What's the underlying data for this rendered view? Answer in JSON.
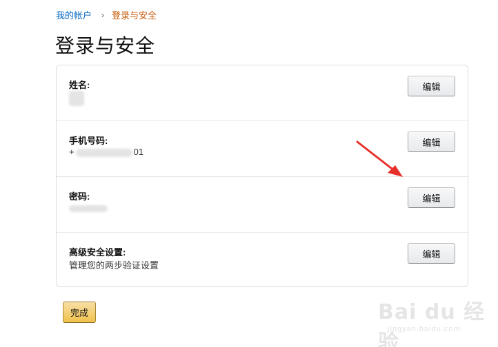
{
  "breadcrumb": {
    "parent": "我的帐户",
    "separator": "›",
    "current": "登录与安全"
  },
  "page": {
    "title": "登录与安全"
  },
  "sections": [
    {
      "label": "姓名:",
      "value_prefix": "",
      "value_suffix": "",
      "value_text": "",
      "edit_label": "编辑"
    },
    {
      "label": "手机号码:",
      "value_prefix": "+",
      "value_suffix": "01",
      "value_text": "",
      "edit_label": "编辑"
    },
    {
      "label": "密码:",
      "value_prefix": "",
      "value_suffix": "",
      "value_text": "",
      "edit_label": "编辑"
    },
    {
      "label": "高级安全设置:",
      "value_prefix": "",
      "value_suffix": "",
      "value_text": "管理您的两步验证设置",
      "edit_label": "编辑"
    }
  ],
  "done_button": {
    "label": "完成"
  },
  "annotation": {
    "arrow_color": "#e8302a"
  },
  "watermark": {
    "main": "Bai du 经验",
    "sub": "jingyan.baidu.com"
  },
  "colors": {
    "link": "#0066c0",
    "breadcrumb_current": "#c45500",
    "primary_button": "#f0c14b"
  }
}
